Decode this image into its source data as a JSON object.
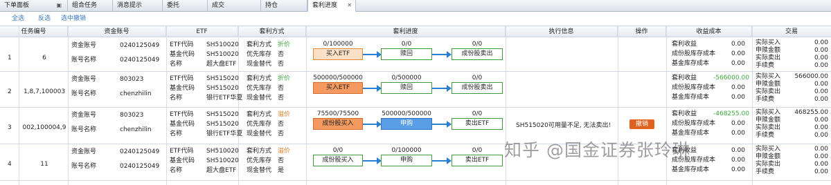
{
  "tabs": [
    {
      "label": "下单面板",
      "icon": "grid-icon"
    },
    {
      "label": "组合任务"
    },
    {
      "label": "消息提示"
    },
    {
      "label": "委托"
    },
    {
      "label": "成交"
    },
    {
      "label": "持仓"
    },
    {
      "label": "套利进度",
      "close": "✕",
      "active": true
    }
  ],
  "actions": [
    "全选",
    "反选",
    "选中撤销"
  ],
  "columns": [
    "任务编号",
    "资金账号",
    "ETF",
    "套利方式",
    "套利进度",
    "执行信息",
    "操作",
    "收益成本",
    "交易"
  ],
  "rows": [
    {
      "index": "1",
      "task_id": "6",
      "account_label": "资金账号",
      "account": "0240125049",
      "name_label": "账号名称",
      "name": "0240125049",
      "etf_code_label": "ETF代码",
      "etf_code": "SH510020",
      "base_code_label": "基金代码",
      "base_code": "SH510020",
      "etf_name_label": "名称",
      "etf_name": "超大盘ETF",
      "mode_label": "套利方式",
      "mode": "折价",
      "stock_label": "优先库存",
      "stock": "否",
      "cash_label": "现金替代",
      "cash": "否",
      "flow": [
        {
          "progress": "0/100000",
          "label": "买入ETF"
        },
        {
          "progress": "0/0",
          "label": "赎回"
        },
        {
          "progress": "0/0",
          "label": "成份股卖出"
        }
      ],
      "exec_info": "",
      "revoke": "",
      "profit_label": "套利收益",
      "profit": "0.00",
      "stock_cost_label": "成份股库存成本",
      "stock_cost": "0.00",
      "fund_cost_label": "基金库存成本",
      "fund_cost": "0.00",
      "trade": [
        {
          "label": "实际买入",
          "value": "0.00"
        },
        {
          "label": "申赎金额",
          "value": "0.00"
        },
        {
          "label": "实际卖出",
          "value": "0.00"
        },
        {
          "label": "手续费",
          "value": "0.00"
        }
      ]
    },
    {
      "index": "2",
      "task_id": "1,8,7,100003",
      "account_label": "资金账号",
      "account": "803023",
      "name_label": "账号名称",
      "name": "chenzhilin",
      "etf_code_label": "ETF代码",
      "etf_code": "SH515020",
      "base_code_label": "基金代码",
      "base_code": "SH515020",
      "etf_name_label": "名称",
      "etf_name": "银行ETF华夏",
      "mode_label": "套利方式",
      "mode": "折价",
      "stock_label": "优先库存",
      "stock": "否",
      "cash_label": "现金替代",
      "cash": "否",
      "flow": [
        {
          "progress": "500000/500000",
          "label": "买入ETF"
        },
        {
          "progress": "0/500000",
          "label": "赎回"
        },
        {
          "progress": "0/0",
          "label": "成份股卖出"
        }
      ],
      "exec_info": "",
      "revoke": "",
      "profit_label": "套利收益",
      "profit": "-566000.00",
      "stock_cost_label": "成份股库存成本",
      "stock_cost": "0.00",
      "fund_cost_label": "基金库存成本",
      "fund_cost": "0.00",
      "trade": [
        {
          "label": "实际买入",
          "value": "566000.00"
        },
        {
          "label": "申赎金额",
          "value": "0.00"
        },
        {
          "label": "实际卖出",
          "value": "0.00"
        },
        {
          "label": "手续费",
          "value": "0.00"
        }
      ]
    },
    {
      "index": "3",
      "task_id": "002,100004,9",
      "account_label": "资金账号",
      "account": "803023",
      "name_label": "账号名称",
      "name": "chenzhilin",
      "etf_code_label": "ETF代码",
      "etf_code": "SH515020",
      "base_code_label": "基金代码",
      "base_code": "SH515020",
      "etf_name_label": "名称",
      "etf_name": "银行ETF华夏",
      "mode_label": "套利方式",
      "mode": "溢价",
      "stock_label": "优先库存",
      "stock": "否",
      "cash_label": "现金替代",
      "cash": "否",
      "flow": [
        {
          "progress": "75500/75500",
          "label": "成份股买入"
        },
        {
          "progress": "500000/500000",
          "label": "申购"
        },
        {
          "progress": "0/0",
          "label": "卖出ETF"
        }
      ],
      "exec_info": "SH515020可用量不足, 无法卖出!",
      "revoke": "撤销",
      "profit_label": "套利收益",
      "profit": "-468255.00",
      "stock_cost_label": "成份股库存成本",
      "stock_cost": "0.00",
      "fund_cost_label": "基金库存成本",
      "fund_cost": "0.00",
      "trade": [
        {
          "label": "实际买入",
          "value": "468255.00"
        },
        {
          "label": "申赎金额",
          "value": "0.00"
        },
        {
          "label": "实际卖出",
          "value": "0.00"
        },
        {
          "label": "手续费",
          "value": "0.00"
        }
      ]
    },
    {
      "index": "4",
      "task_id": "11",
      "account_label": "资金账号",
      "account": "0240125049",
      "name_label": "账号名称",
      "name": "0240125049",
      "etf_code_label": "ETF代码",
      "etf_code": "SH510020",
      "base_code_label": "基金代码",
      "base_code": "SH510020",
      "etf_name_label": "名称",
      "etf_name": "超大盘ETF",
      "mode_label": "套利方式",
      "mode": "溢价",
      "stock_label": "优先库存",
      "stock": "否",
      "cash_label": "现金替代",
      "cash": "是",
      "flow": [
        {
          "progress": "0/0",
          "label": "成份股买入"
        },
        {
          "progress": "0/100000",
          "label": "申购"
        },
        {
          "progress": "0/0",
          "label": "卖出ETF"
        }
      ],
      "exec_info": "",
      "revoke": "",
      "profit_label": "套利收益",
      "profit": "0.00",
      "stock_cost_label": "成份股库存成本",
      "stock_cost": "0.00",
      "fund_cost_label": "基金库存成本",
      "fund_cost": "0.00",
      "trade": [
        {
          "label": "实际买入",
          "value": "0.00"
        },
        {
          "label": "申赎金额",
          "value": "0.00"
        },
        {
          "label": "实际卖出",
          "value": "0.00"
        },
        {
          "label": "手续费",
          "value": "0.00"
        }
      ]
    }
  ],
  "watermark": "知乎 @国金证券张玲琳",
  "colors": {
    "green": "#3aa83a",
    "orange": "#e07a20",
    "arrow": "#2a7fd0",
    "revoke": "#e0621f"
  }
}
